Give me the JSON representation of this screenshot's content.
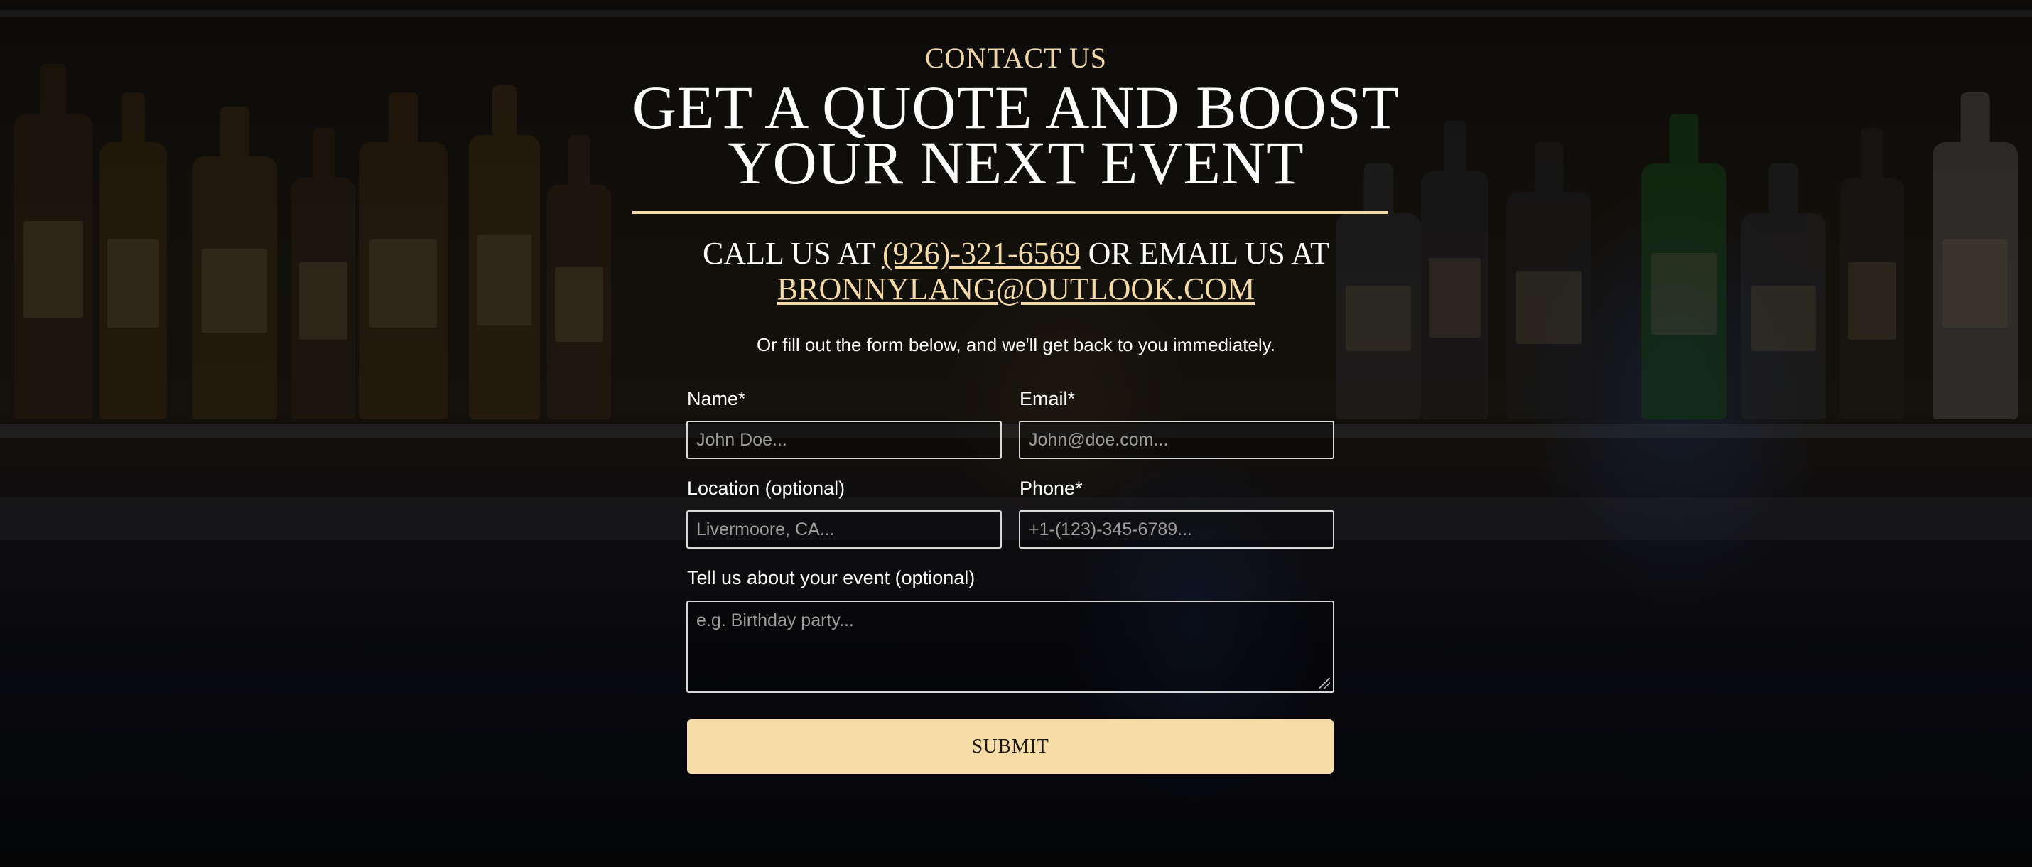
{
  "section": {
    "eyebrow": "CONTACT US",
    "headline": "GET A QUOTE AND BOOST YOUR NEXT EVENT",
    "call_prefix": "CALL US AT ",
    "phone": "(926)-321-6569",
    "email_prefix": " OR EMAIL US AT ",
    "email": "BRONNYLANG@OUTLOOK.COM",
    "intro": "Or fill out the form below, and we'll get back to you immediately."
  },
  "form": {
    "name": {
      "label": "Name*",
      "placeholder": "John Doe..."
    },
    "email": {
      "label": "Email*",
      "placeholder": "John@doe.com..."
    },
    "location": {
      "label": "Location (optional)",
      "placeholder": "Livermoore, CA..."
    },
    "phone": {
      "label": "Phone*",
      "placeholder": "+1-(123)-345-6789..."
    },
    "event": {
      "label": "Tell us about your event (optional)",
      "placeholder": "e.g. Birthday party..."
    },
    "submit_label": "SUBMIT"
  },
  "colors": {
    "accent": "#f4dba6",
    "text": "#ffffff",
    "background": "#0a0a0a"
  }
}
